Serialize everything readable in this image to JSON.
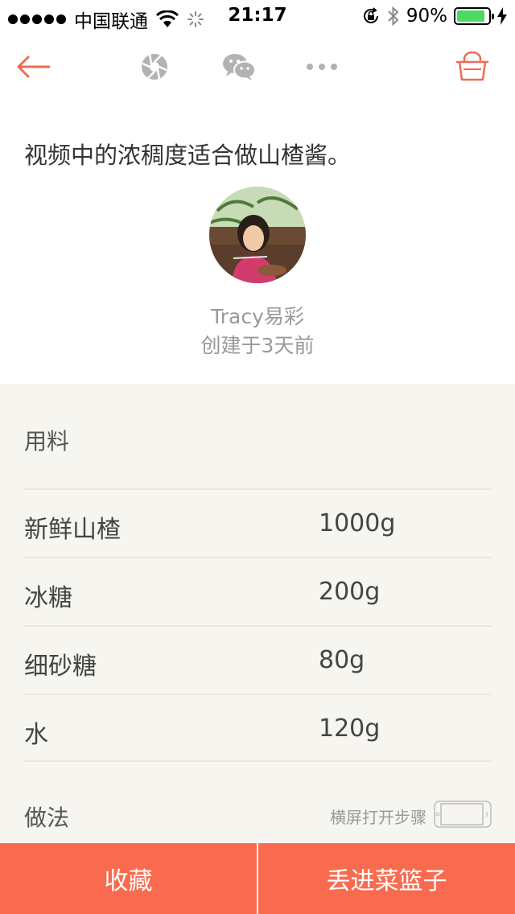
{
  "status_bar": {
    "carrier": "中国联通",
    "time": "21:17",
    "battery": "90%",
    "battery_level": 0.9
  },
  "nav": {
    "icons": [
      "back-arrow-icon",
      "aperture-icon",
      "wechat-icon",
      "more-icon",
      "basket-icon"
    ]
  },
  "recipe": {
    "description": "视频中的浓稠度适合做山楂酱。",
    "author": "Tracy易彩",
    "created": "创建于3天前"
  },
  "ingredients": {
    "title": "用料",
    "items": [
      {
        "name": "新鲜山楂",
        "amount": "1000g"
      },
      {
        "name": "冰糖",
        "amount": "200g"
      },
      {
        "name": "细砂糖",
        "amount": "80g"
      },
      {
        "name": "水",
        "amount": "120g"
      }
    ]
  },
  "steps": {
    "title": "做法",
    "landscape_hint": "横屏打开步骤"
  },
  "actions": {
    "favorite": "收藏",
    "add_to_basket": "丢进菜篮子"
  },
  "colors": {
    "accent": "#f86b4f",
    "panel": "#f6f5ef",
    "battery": "#4cd964"
  }
}
